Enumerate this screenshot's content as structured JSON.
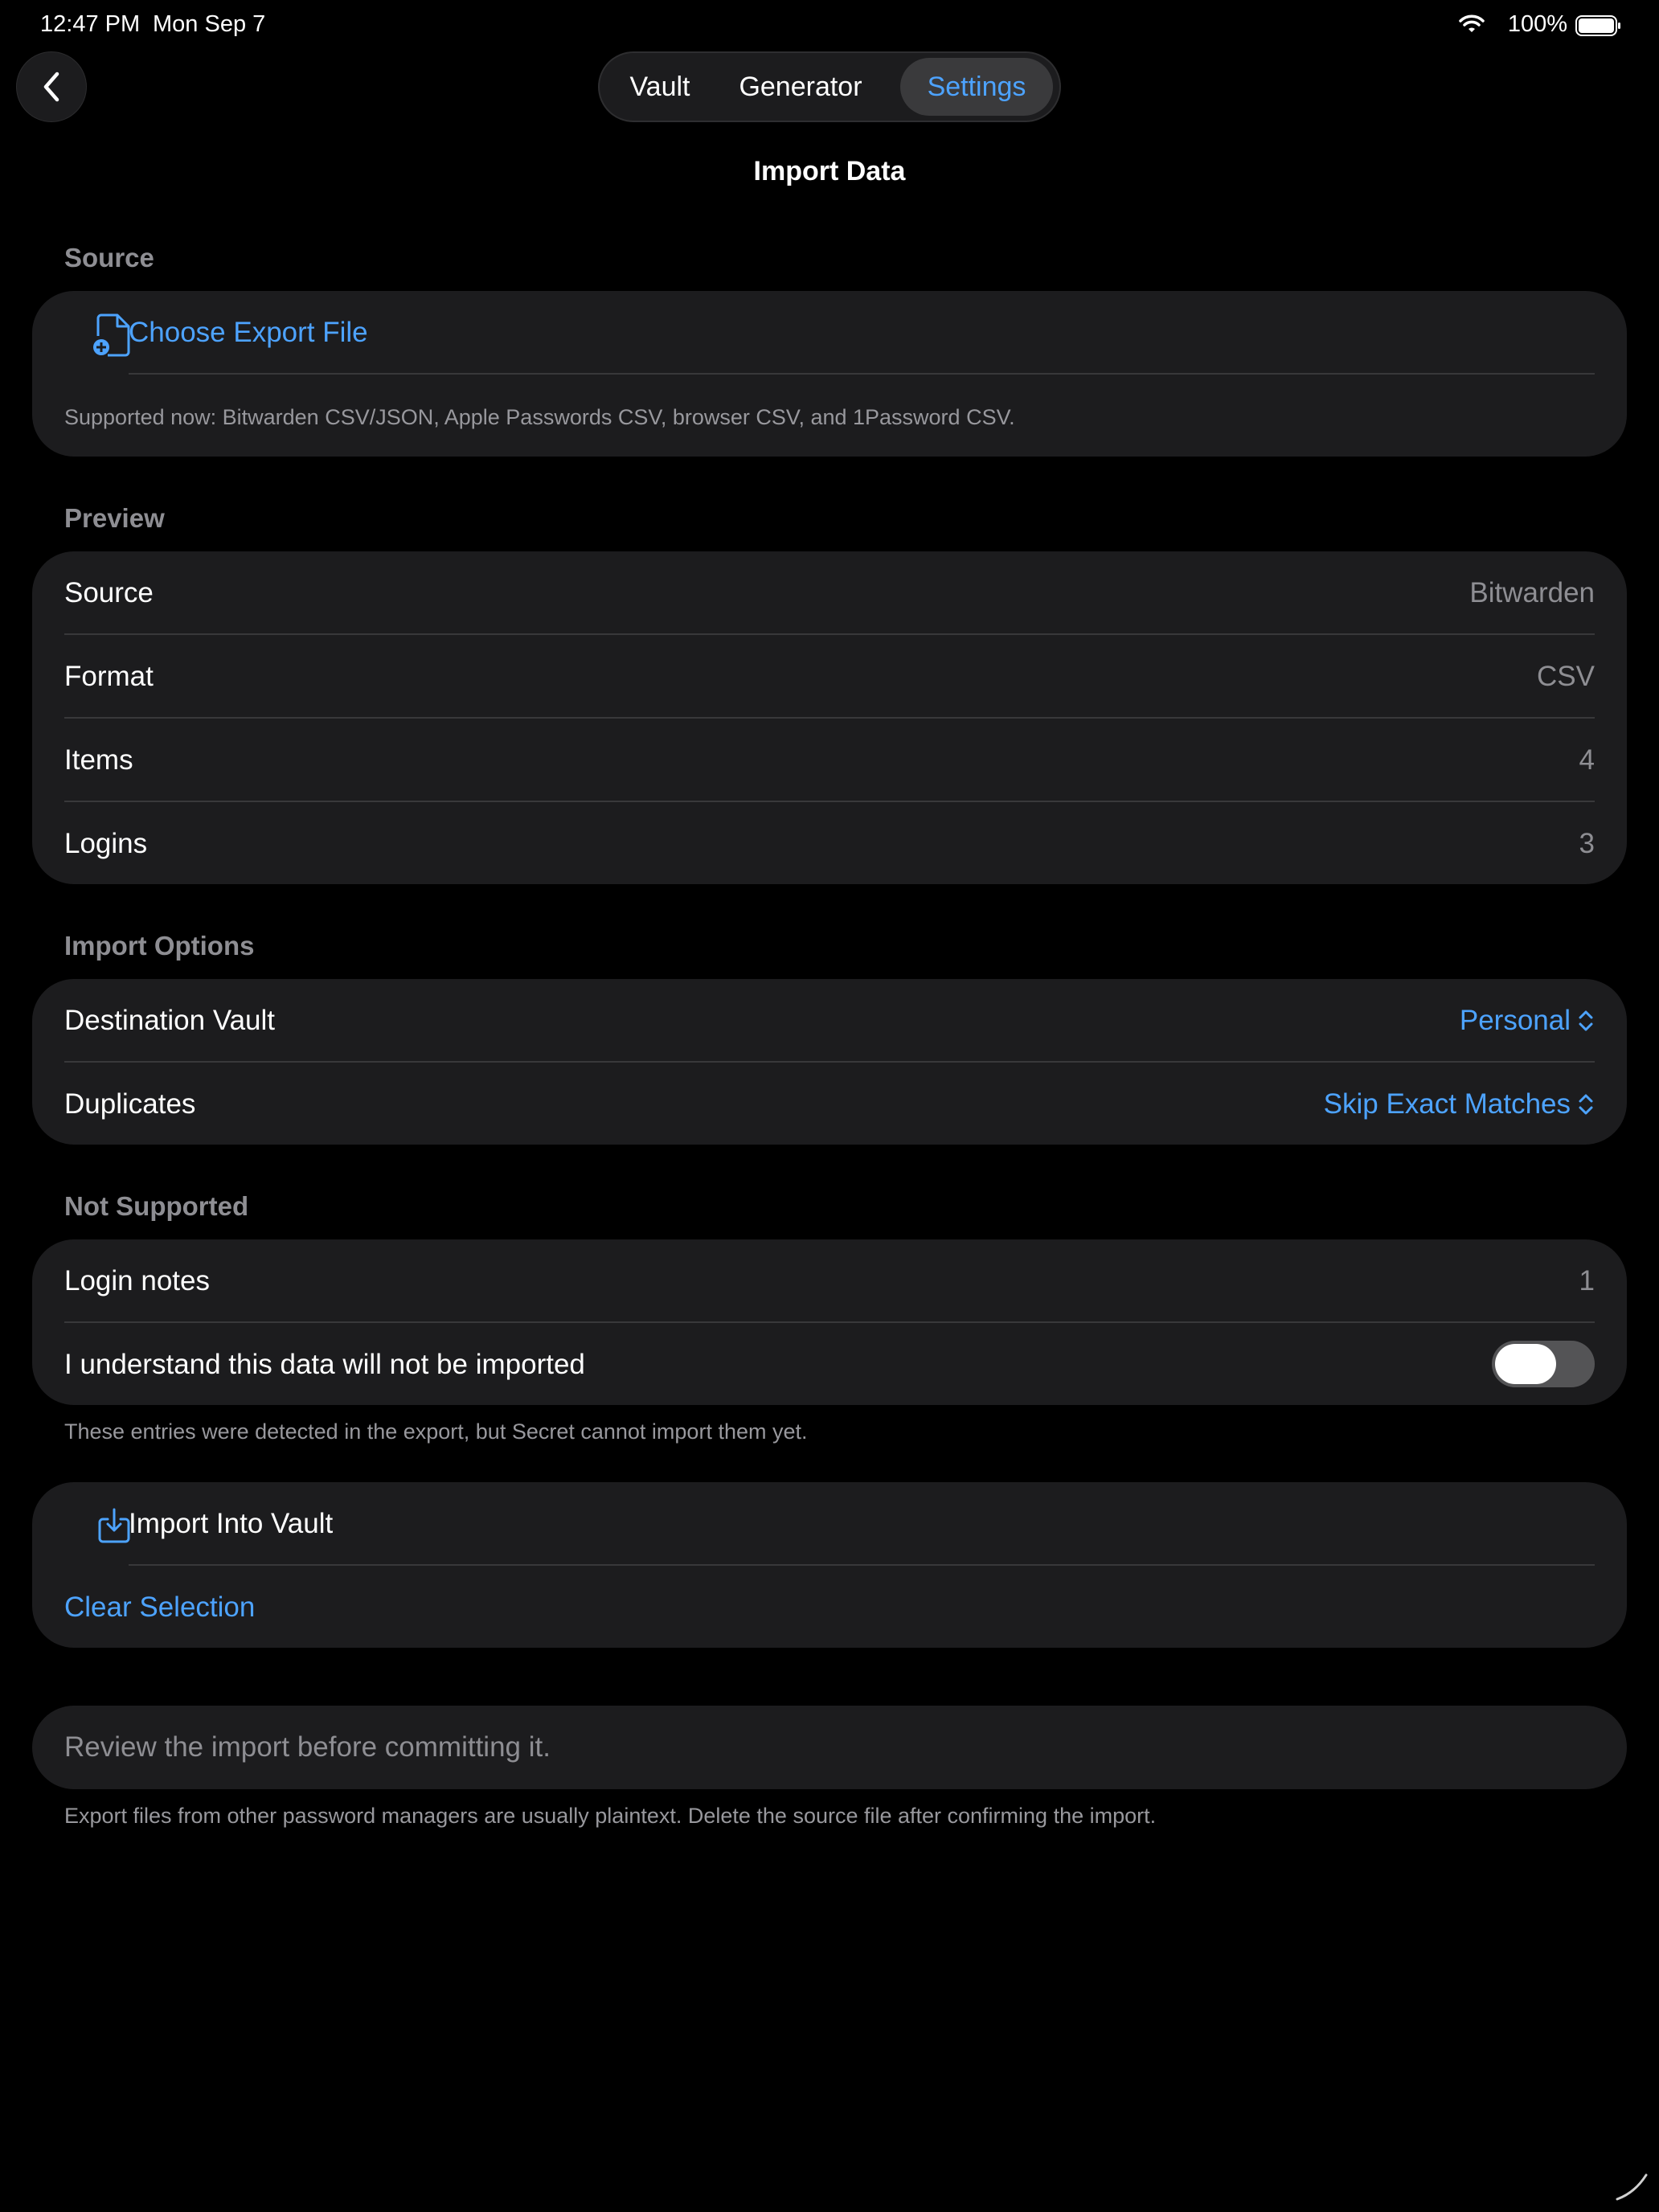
{
  "status_bar": {
    "time": "12:47 PM",
    "date": "Mon Sep 7",
    "battery": "100%"
  },
  "nav": {
    "back_icon": "chevron-left-icon",
    "tabs": [
      {
        "label": "Vault",
        "selected": false
      },
      {
        "label": "Generator",
        "selected": false
      },
      {
        "label": "Settings",
        "selected": true
      }
    ]
  },
  "page": {
    "title": "Import Data"
  },
  "source_section": {
    "header": "Source",
    "choose_label": "Choose Export File",
    "choose_icon": "document-add-icon",
    "supported_text": "Supported now: Bitwarden CSV/JSON, Apple Passwords CSV, browser CSV, and 1Password CSV."
  },
  "preview_section": {
    "header": "Preview",
    "rows": [
      {
        "label": "Source",
        "value": "Bitwarden"
      },
      {
        "label": "Format",
        "value": "CSV"
      },
      {
        "label": "Items",
        "value": "4"
      },
      {
        "label": "Logins",
        "value": "3"
      }
    ]
  },
  "options_section": {
    "header": "Import Options",
    "destination_label": "Destination Vault",
    "destination_value": "Personal",
    "duplicates_label": "Duplicates",
    "duplicates_value": "Skip Exact Matches"
  },
  "unsupported_section": {
    "header": "Not Supported",
    "notes_label": "Login notes",
    "notes_value": "1",
    "ack_label": "I understand this data will not be imported",
    "ack_on": false,
    "footnote": "These entries were detected in the export, but Secret cannot import them yet."
  },
  "actions": {
    "import_label": "Import Into Vault",
    "import_icon": "import-tray-icon",
    "clear_label": "Clear Selection"
  },
  "review": {
    "message": "Review the import before committing it.",
    "footnote": "Export files from other password managers are usually plaintext. Delete the source file after confirming the import."
  },
  "colors": {
    "accent": "#4da3ff",
    "card": "#1c1c1e",
    "background": "#000000",
    "secondary_text": "#8e8e93"
  }
}
